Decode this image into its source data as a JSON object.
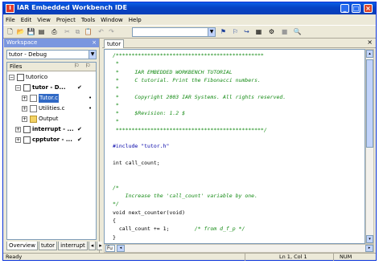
{
  "window": {
    "title": "IAR Embedded Workbench IDE",
    "app_icon": "iar-logo-icon"
  },
  "caption_buttons": {
    "minimize": "_",
    "maximize": "□",
    "close": "×"
  },
  "menu": [
    "File",
    "Edit",
    "View",
    "Project",
    "Tools",
    "Window",
    "Help"
  ],
  "toolbar": {
    "icons": [
      "new-file-icon",
      "open-icon",
      "save-icon",
      "save-all-icon",
      "print-icon",
      "cut-icon",
      "copy-icon",
      "paste-icon",
      "undo-icon",
      "redo-icon",
      "find-combo",
      "toggle-bookmark-icon",
      "next-bookmark-icon",
      "go-to-icon",
      "compile-icon",
      "make-icon",
      "stop-build-icon",
      "debug-icon"
    ],
    "find_value": "",
    "glyphs": {
      "new": "🗋",
      "open": "📂",
      "save": "💾",
      "saveall": "▤",
      "print": "⎙",
      "cut": "✂",
      "copy": "⧉",
      "paste": "📋",
      "undo": "↶",
      "redo": "↷",
      "bm1": "⚑",
      "bm2": "⚐",
      "goto": "↪",
      "compile": "▦",
      "make": "⚙",
      "stop": "■",
      "debug": "🔍"
    }
  },
  "workspace": {
    "title": "Workspace",
    "close": "×",
    "configuration": "tutor - Debug",
    "columns": {
      "files": "Files",
      "col2": "⚐",
      "col3": "⚐"
    },
    "tree": [
      {
        "label": "tutorico",
        "depth": 0,
        "exp": "−",
        "icon": "workspace",
        "check": "",
        "dot": ""
      },
      {
        "label": "tutor - D...",
        "depth": 1,
        "exp": "−",
        "icon": "project",
        "check": "✔",
        "dot": ""
      },
      {
        "label": "Tutor.c",
        "depth": 2,
        "exp": "+",
        "icon": "file",
        "check": "",
        "dot": "•",
        "selected": true
      },
      {
        "label": "Utilities.c",
        "depth": 2,
        "exp": "+",
        "icon": "file",
        "check": "",
        "dot": "•"
      },
      {
        "label": "Output",
        "depth": 2,
        "exp": "+",
        "icon": "folder",
        "check": "",
        "dot": ""
      },
      {
        "label": "interrupt - ...",
        "depth": 1,
        "exp": "+",
        "icon": "project",
        "check": "✔",
        "dot": ""
      },
      {
        "label": "cpptutor - ...",
        "depth": 1,
        "exp": "+",
        "icon": "project",
        "check": "✔",
        "dot": ""
      }
    ],
    "tabs": [
      "Overview",
      "tutor",
      "interrupt"
    ],
    "tab_scroll": {
      "left": "◂",
      "right": "▸"
    }
  },
  "editor": {
    "tab": "tutor",
    "close": "×",
    "lines": [
      {
        "t": "/***********************************************",
        "c": "c-com"
      },
      {
        "t": " *",
        "c": "c-com"
      },
      {
        "t": " *     IAR EMBEDDED WORKBENCH TUTORIAL",
        "c": "c-com"
      },
      {
        "t": " *     C tutorial. Print the Fibonacci numbers.",
        "c": "c-com"
      },
      {
        "t": " *",
        "c": "c-com"
      },
      {
        "t": " *     Copyright 2003 IAR Systems. All rights reserved.",
        "c": "c-com"
      },
      {
        "t": " *",
        "c": "c-com"
      },
      {
        "t": " *     $Revision: 1.2 $",
        "c": "c-com"
      },
      {
        "t": " *",
        "c": "c-com"
      },
      {
        "t": " ***********************************************/",
        "c": "c-com"
      },
      {
        "t": "",
        "c": ""
      },
      {
        "t": "#include \"tutor.h\"",
        "c": "c-pre"
      },
      {
        "t": "",
        "c": ""
      },
      {
        "t": "int call_count;",
        "c": "c-kw"
      },
      {
        "t": "",
        "c": ""
      },
      {
        "t": "",
        "c": ""
      },
      {
        "t": "/*",
        "c": "c-com"
      },
      {
        "t": "    Increase the 'call_count' variable by one.",
        "c": "c-com"
      },
      {
        "t": "*/",
        "c": "c-com"
      },
      {
        "t": "void next_counter(void)",
        "c": "c-kw"
      },
      {
        "t": "{",
        "c": "c-kw"
      },
      {
        "t": "  call_count += 1;        /* from d_f_p */",
        "c": "mixed"
      },
      {
        "t": "}",
        "c": "c-kw"
      }
    ],
    "mixed_line": {
      "code": "  call_count += 1;",
      "comment": "        /* from d_f_p */"
    },
    "scroll": {
      "up": "▴",
      "down": "▾",
      "left": "◂",
      "right": "▸"
    },
    "func_box": "Fu"
  },
  "status": {
    "ready": "Ready",
    "position": "Ln 1, Col 1",
    "num": "NUM"
  }
}
